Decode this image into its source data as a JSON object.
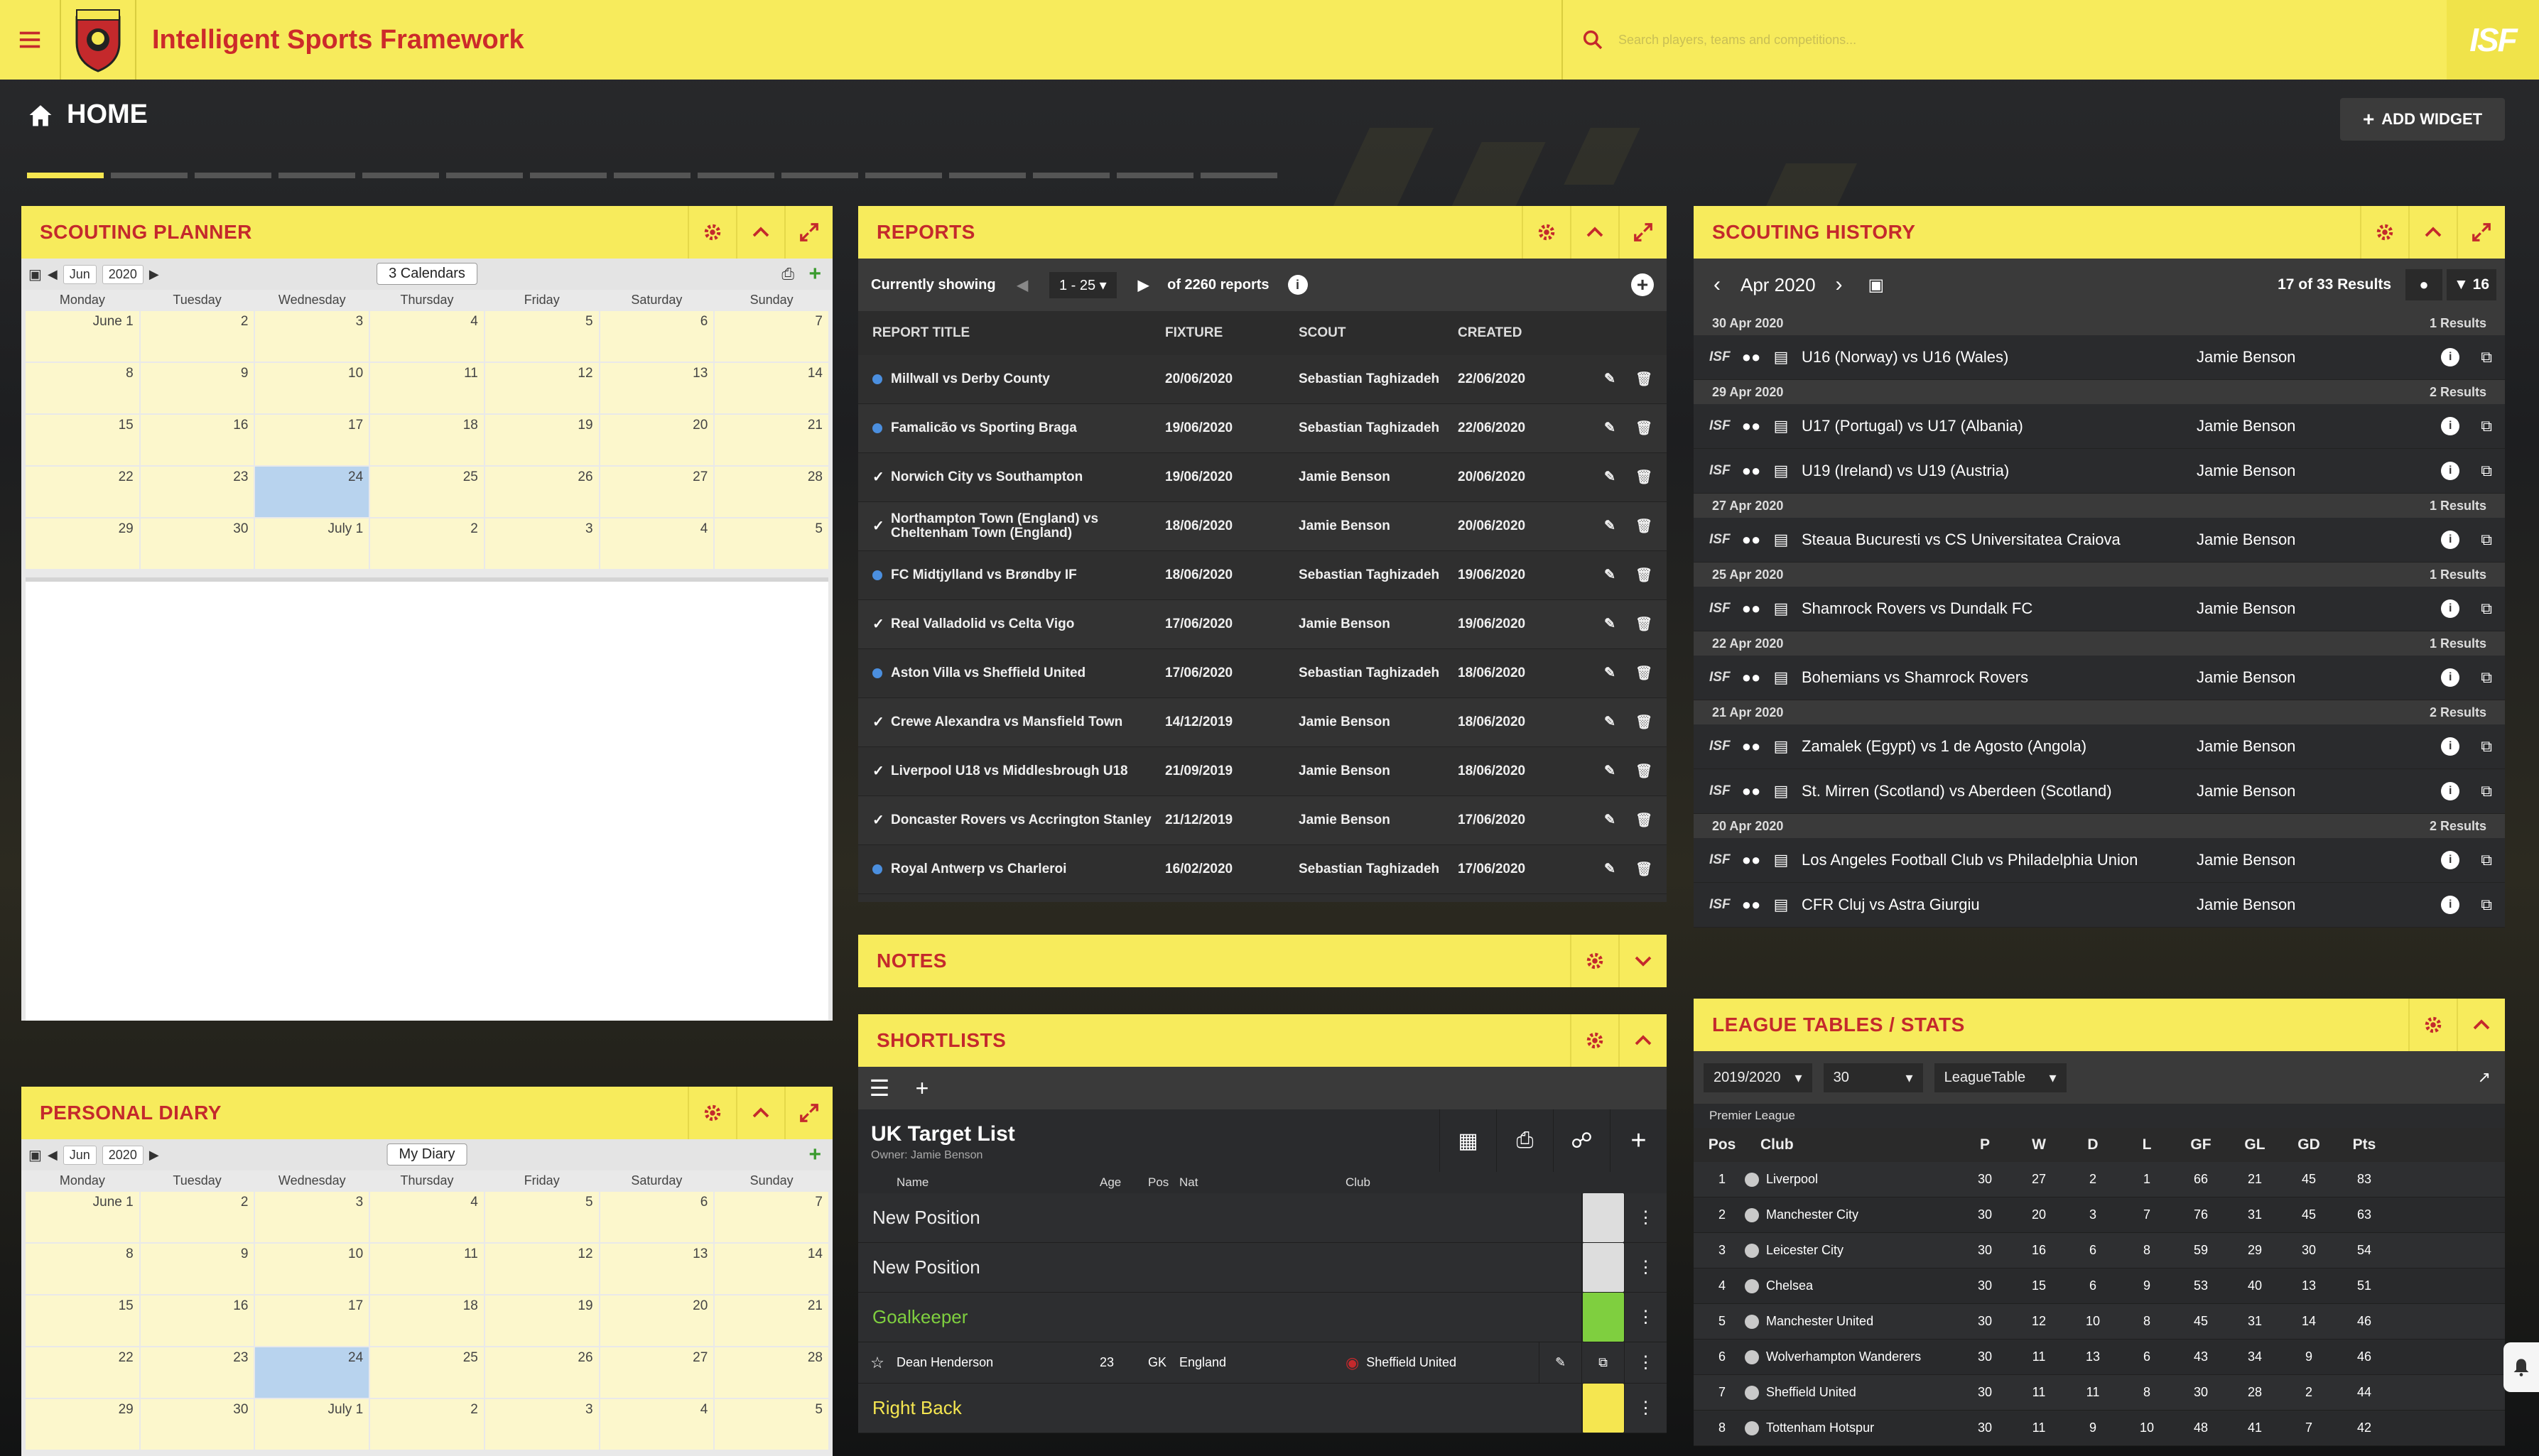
{
  "app": {
    "title": "Intelligent Sports Framework",
    "badge": "ISF"
  },
  "search": {
    "placeholder": "Search players, teams and competitions..."
  },
  "page": {
    "title": "HOME",
    "add_widget": "ADD WIDGET"
  },
  "colors": {
    "accent": "#f7eb5c",
    "title_red": "#c4292c",
    "today": "#b8d3ee",
    "dot_blue": "#4b8fdf"
  },
  "scouting_planner": {
    "title": "SCOUTING PLANNER",
    "month": "Jun",
    "year": "2020",
    "button": "3 Calendars",
    "days": [
      "Monday",
      "Tuesday",
      "Wednesday",
      "Thursday",
      "Friday",
      "Saturday",
      "Sunday"
    ],
    "weeks": [
      [
        "June 1",
        "2",
        "3",
        "4",
        "5",
        "6",
        "7"
      ],
      [
        "8",
        "9",
        "10",
        "11",
        "12",
        "13",
        "14"
      ],
      [
        "15",
        "16",
        "17",
        "18",
        "19",
        "20",
        "21"
      ],
      [
        "22",
        "23",
        "24",
        "25",
        "26",
        "27",
        "28"
      ],
      [
        "29",
        "30",
        "July 1",
        "2",
        "3",
        "4",
        "5"
      ]
    ]
  },
  "personal_diary": {
    "title": "PERSONAL DIARY",
    "month": "Jun",
    "year": "2020",
    "button": "My Diary",
    "days": [
      "Monday",
      "Tuesday",
      "Wednesday",
      "Thursday",
      "Friday",
      "Saturday",
      "Sunday"
    ],
    "weeks": [
      [
        "June 1",
        "2",
        "3",
        "4",
        "5",
        "6",
        "7"
      ],
      [
        "8",
        "9",
        "10",
        "11",
        "12",
        "13",
        "14"
      ],
      [
        "15",
        "16",
        "17",
        "18",
        "19",
        "20",
        "21"
      ],
      [
        "22",
        "23",
        "24",
        "25",
        "26",
        "27",
        "28"
      ],
      [
        "29",
        "30",
        "July 1",
        "2",
        "3",
        "4",
        "5"
      ]
    ]
  },
  "reports": {
    "title": "REPORTS",
    "showing_label": "Currently showing",
    "range": "1 - 25",
    "of_total": "of 2260 reports",
    "columns": [
      "REPORT TITLE",
      "FIXTURE",
      "SCOUT",
      "CREATED"
    ],
    "rows": [
      {
        "status": "dot",
        "title": "Millwall vs Derby County",
        "fixture": "20/06/2020",
        "scout": "Sebastian Taghizadeh",
        "created": "22/06/2020"
      },
      {
        "status": "dot",
        "title": "Famalicão vs Sporting Braga",
        "fixture": "19/06/2020",
        "scout": "Sebastian Taghizadeh",
        "created": "22/06/2020"
      },
      {
        "status": "tick",
        "title": "Norwich City vs Southampton",
        "fixture": "19/06/2020",
        "scout": "Jamie Benson",
        "created": "20/06/2020"
      },
      {
        "status": "tick",
        "title": "Northampton Town (England) vs Cheltenham Town (England)",
        "fixture": "18/06/2020",
        "scout": "Jamie Benson",
        "created": "20/06/2020"
      },
      {
        "status": "dot",
        "title": "FC Midtjylland vs Brøndby IF",
        "fixture": "18/06/2020",
        "scout": "Sebastian Taghizadeh",
        "created": "19/06/2020"
      },
      {
        "status": "tick",
        "title": "Real Valladolid vs Celta Vigo",
        "fixture": "17/06/2020",
        "scout": "Jamie Benson",
        "created": "19/06/2020"
      },
      {
        "status": "dot",
        "title": "Aston Villa vs Sheffield United",
        "fixture": "17/06/2020",
        "scout": "Sebastian Taghizadeh",
        "created": "18/06/2020"
      },
      {
        "status": "tick",
        "title": "Crewe Alexandra vs Mansfield Town",
        "fixture": "14/12/2019",
        "scout": "Jamie Benson",
        "created": "18/06/2020"
      },
      {
        "status": "tick",
        "title": "Liverpool U18 vs Middlesbrough U18",
        "fixture": "21/09/2019",
        "scout": "Jamie Benson",
        "created": "18/06/2020"
      },
      {
        "status": "tick",
        "title": "Doncaster Rovers vs Accrington Stanley",
        "fixture": "21/12/2019",
        "scout": "Jamie Benson",
        "created": "17/06/2020"
      },
      {
        "status": "dot",
        "title": "Royal Antwerp vs Charleroi",
        "fixture": "16/02/2020",
        "scout": "Sebastian Taghizadeh",
        "created": "17/06/2020"
      }
    ]
  },
  "notes": {
    "title": "NOTES"
  },
  "shortlists": {
    "title": "SHORTLISTS",
    "list_name": "UK Target List",
    "owner": "Owner: Jamie Benson",
    "columns": [
      "Name",
      "Age",
      "Pos",
      "Nat",
      "Club"
    ],
    "rows": [
      {
        "type": "group",
        "label": "New Position",
        "color": "#eeeeee"
      },
      {
        "type": "group",
        "label": "New Position",
        "color": "#eeeeee"
      },
      {
        "type": "group",
        "label": "Goalkeeper",
        "color": "#7fcf3f"
      },
      {
        "type": "player",
        "name": "Dean Henderson",
        "age": "23",
        "pos": "GK",
        "nat": "England",
        "club": "Sheffield United"
      },
      {
        "type": "group",
        "label": "Right Back",
        "color": "#f5e650"
      }
    ]
  },
  "scouting_history": {
    "title": "SCOUTING HISTORY",
    "month": "Apr 2020",
    "results": "17 of 33 Results",
    "filter_count": "16",
    "groups": [
      {
        "date": "30 Apr 2020",
        "count": "1 Results",
        "items": [
          {
            "title": "U16 (Norway) vs U16 (Wales)",
            "scout": "Jamie Benson"
          }
        ]
      },
      {
        "date": "29 Apr 2020",
        "count": "2 Results",
        "items": [
          {
            "title": "U17 (Portugal) vs U17 (Albania)",
            "scout": "Jamie Benson"
          },
          {
            "title": "U19 (Ireland) vs U19 (Austria)",
            "scout": "Jamie Benson"
          }
        ]
      },
      {
        "date": "27 Apr 2020",
        "count": "1 Results",
        "items": [
          {
            "title": "Steaua Bucuresti vs CS Universitatea Craiova",
            "scout": "Jamie Benson"
          }
        ]
      },
      {
        "date": "25 Apr 2020",
        "count": "1 Results",
        "items": [
          {
            "title": "Shamrock Rovers vs Dundalk FC",
            "scout": "Jamie Benson"
          }
        ]
      },
      {
        "date": "22 Apr 2020",
        "count": "1 Results",
        "items": [
          {
            "title": "Bohemians vs Shamrock Rovers",
            "scout": "Jamie Benson"
          }
        ]
      },
      {
        "date": "21 Apr 2020",
        "count": "2 Results",
        "items": [
          {
            "title": "Zamalek (Egypt) vs 1 de Agosto (Angola)",
            "scout": "Jamie Benson"
          },
          {
            "title": "St. Mirren (Scotland) vs Aberdeen (Scotland)",
            "scout": "Jamie Benson"
          }
        ]
      },
      {
        "date": "20 Apr 2020",
        "count": "2 Results",
        "items": [
          {
            "title": "Los Angeles Football Club vs Philadelphia Union",
            "scout": "Jamie Benson"
          },
          {
            "title": "CFR Cluj vs Astra Giurgiu",
            "scout": "Jamie Benson"
          }
        ]
      }
    ]
  },
  "league_tables": {
    "title": "LEAGUE TABLES / STATS",
    "season": "2019/2020",
    "round": "30",
    "view": "LeagueTable",
    "league": "Premier League",
    "columns": [
      "Pos",
      "Club",
      "P",
      "W",
      "D",
      "L",
      "GF",
      "GL",
      "GD",
      "Pts"
    ],
    "rows": [
      [
        "1",
        "Liverpool",
        "30",
        "27",
        "2",
        "1",
        "66",
        "21",
        "45",
        "83"
      ],
      [
        "2",
        "Manchester City",
        "30",
        "20",
        "3",
        "7",
        "76",
        "31",
        "45",
        "63"
      ],
      [
        "3",
        "Leicester City",
        "30",
        "16",
        "6",
        "8",
        "59",
        "29",
        "30",
        "54"
      ],
      [
        "4",
        "Chelsea",
        "30",
        "15",
        "6",
        "9",
        "53",
        "40",
        "13",
        "51"
      ],
      [
        "5",
        "Manchester United",
        "30",
        "12",
        "10",
        "8",
        "45",
        "31",
        "14",
        "46"
      ],
      [
        "6",
        "Wolverhampton Wanderers",
        "30",
        "11",
        "13",
        "6",
        "43",
        "34",
        "9",
        "46"
      ],
      [
        "7",
        "Sheffield United",
        "30",
        "11",
        "11",
        "8",
        "30",
        "28",
        "2",
        "44"
      ],
      [
        "8",
        "Tottenham Hotspur",
        "30",
        "11",
        "9",
        "10",
        "48",
        "41",
        "7",
        "42"
      ]
    ]
  }
}
